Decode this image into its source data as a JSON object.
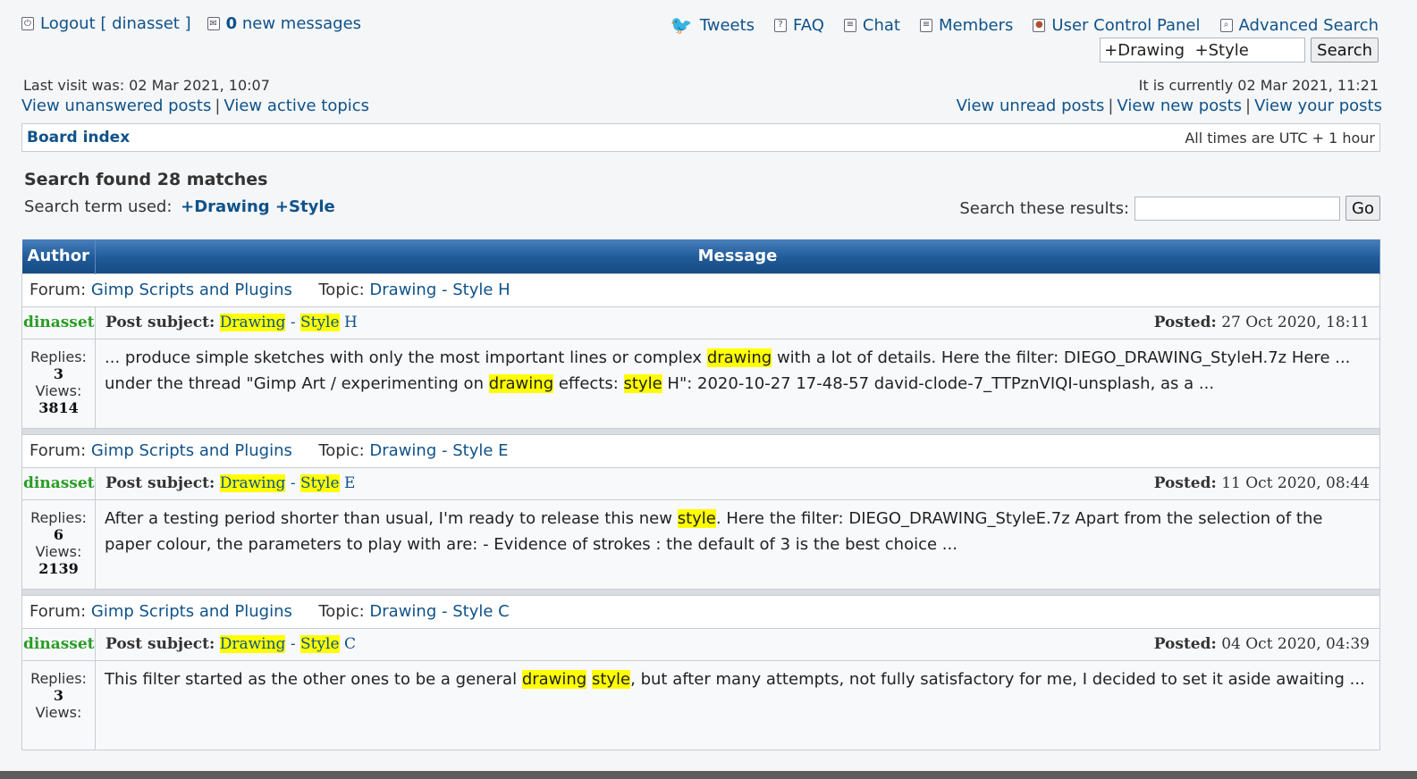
{
  "top": {
    "logout": "Logout [ dinasset ]",
    "new_count": "0",
    "new_messages": "new messages",
    "tweets": "Tweets",
    "faq": "FAQ",
    "chat": "Chat",
    "members": "Members",
    "ucp": "User Control Panel",
    "advanced_search": "Advanced Search",
    "search_value": "+Drawing  +Style",
    "search_button": "Search"
  },
  "info": {
    "last_visit": "Last visit was: 02 Mar 2021, 10:07",
    "current_time": "It is currently 02 Mar 2021, 11:21",
    "unanswered": "View unanswered posts",
    "active": "View active topics",
    "unread": "View unread posts",
    "new_posts": "View new posts",
    "your_posts": "View your posts",
    "sep": "|"
  },
  "nav": {
    "board_index": "Board index",
    "timezone": "All times are UTC + 1 hour"
  },
  "search": {
    "found": "Search found 28 matches",
    "term_label": "Search term used:",
    "term": "+Drawing +Style",
    "these_results": "Search these results:",
    "go": "Go"
  },
  "table": {
    "author_header": "Author",
    "message_header": "Message",
    "forum_label": "Forum:",
    "topic_label": "Topic:",
    "subject_label": "Post subject:",
    "posted_label": "Posted:",
    "replies_label": "Replies:",
    "views_label": "Views:",
    "dash": "-"
  },
  "results": [
    {
      "forum": "Gimp Scripts and Plugins",
      "topic": "Drawing - Style H",
      "author": "dinasset",
      "subject_w1": "Drawing",
      "subject_w2": "Style",
      "subject_tail": "H",
      "posted": "27 Oct 2020, 18:11",
      "replies": "3",
      "views": "3814",
      "msg_a": "... produce simple sketches with only the most important lines or complex ",
      "msg_h1": "drawing",
      "msg_b": " with a lot of details. Here the filter: DIEGO_DRAWING_StyleH.7z Here ... under the thread \"Gimp Art / experimenting on ",
      "msg_h2": "drawing",
      "msg_c": " effects: ",
      "msg_h3": "style",
      "msg_d": " H\": 2020-10-27 17-48-57 david-clode-7_TTPznVIQI-unsplash, as a ..."
    },
    {
      "forum": "Gimp Scripts and Plugins",
      "topic": "Drawing - Style E",
      "author": "dinasset",
      "subject_w1": "Drawing",
      "subject_w2": "Style",
      "subject_tail": "E",
      "posted": "11 Oct 2020, 08:44",
      "replies": "6",
      "views": "2139",
      "msg_a": "After a testing period shorter than usual, I'm ready to release this new ",
      "msg_h1": "style",
      "msg_b": ". Here the filter: DIEGO_DRAWING_StyleE.7z Apart from the selection of the paper colour, the parameters to play with are: - Evidence of strokes : the default of 3 is the best choice ..."
    },
    {
      "forum": "Gimp Scripts and Plugins",
      "topic": "Drawing - Style C",
      "author": "dinasset",
      "subject_w1": "Drawing",
      "subject_w2": "Style",
      "subject_tail": "C",
      "posted": "04 Oct 2020, 04:39",
      "replies": "3",
      "msg_a": "This filter started as the other ones to be a general ",
      "msg_h1": "drawing",
      "msg_sp": " ",
      "msg_h2": "style",
      "msg_b": ", but after many attempts, not fully satisfactory for me, I decided to set it aside awaiting ..."
    }
  ]
}
